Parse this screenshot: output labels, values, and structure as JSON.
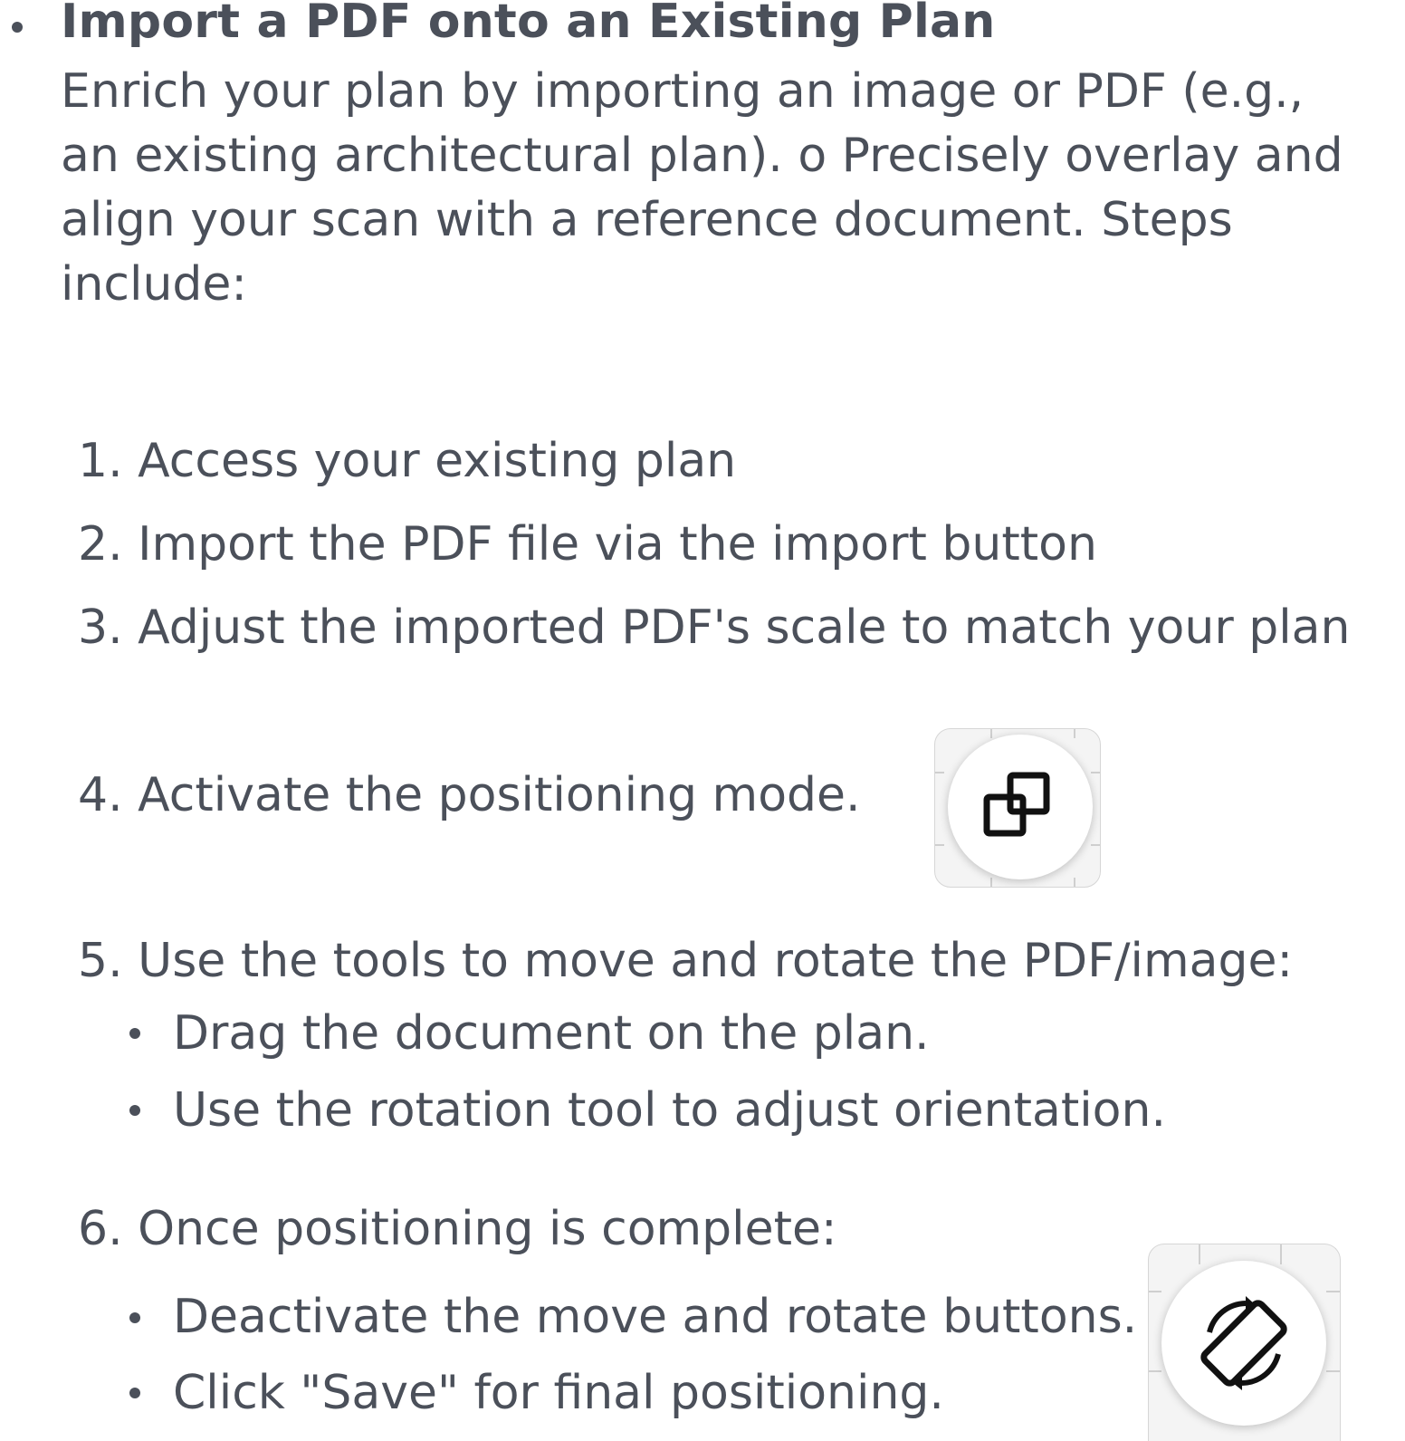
{
  "section": {
    "title": "Import a PDF onto an Existing Plan",
    "paragraph_lines": [
      "Enrich your plan by importing an image or PDF (e.g.,",
      "an existing architectural plan). o Precisely overlay and",
      "align your scan with a reference document. Steps",
      "include:"
    ]
  },
  "steps": [
    {
      "label": "1. Access your existing plan"
    },
    {
      "label": "2. Import the PDF file via the import button"
    },
    {
      "label": "3. Adjust the imported PDF's scale to match your plan"
    },
    {
      "label": "4. Activate the positioning mode.",
      "icon": "positioning-mode-icon"
    },
    {
      "label": "5. Use the tools to move and rotate the PDF/image:",
      "subitems": [
        "Drag the document on the plan.",
        "Use the rotation tool to adjust orientation."
      ]
    },
    {
      "label": "6. Once positioning is complete:",
      "icon": "rotate-icon",
      "subitems": [
        "Deactivate the move and rotate buttons.",
        "Click \"Save\" for final positioning."
      ]
    }
  ],
  "colors": {
    "text": "#4b505a",
    "icon_stroke": "#111111",
    "tile_background": "#f4f4f4"
  }
}
